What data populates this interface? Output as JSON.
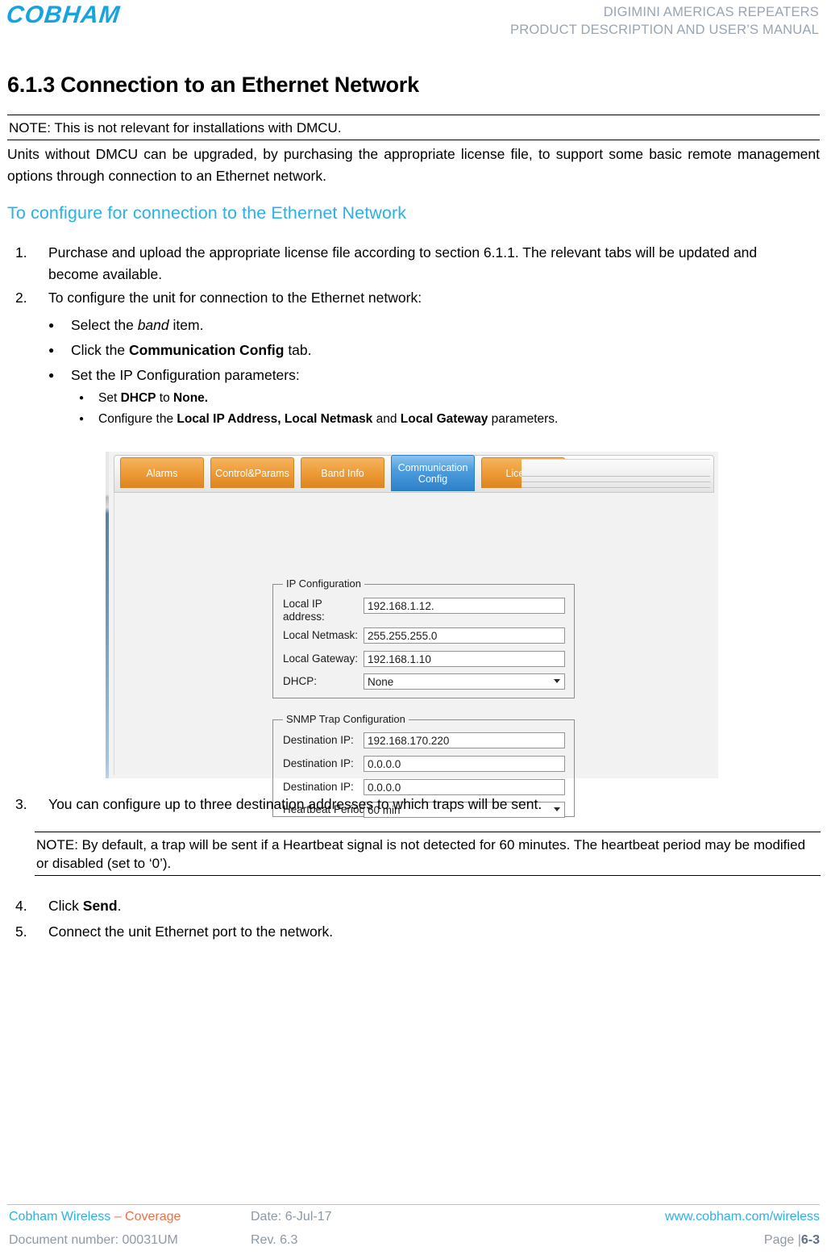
{
  "header": {
    "logo_text": "COBHAM",
    "line1": "DIGIMINI AMERICAS REPEATERS",
    "line2": "PRODUCT DESCRIPTION AND USER’S MANUAL"
  },
  "section": {
    "number": "6.1.3",
    "title": "Connection to an Ethernet Network"
  },
  "notes": {
    "note1": "NOTE: This is not relevant for installations with DMCU.",
    "note2": "NOTE: By default, a trap will be sent if a Heartbeat signal is not detected for 60 minutes. The heartbeat period may be modified or disabled (set to ‘0’)."
  },
  "intro_paragraph": "Units without DMCU can be upgraded, by purchasing the appropriate license file, to support some basic remote management options through connection to an Ethernet network.",
  "blue_heading": "To configure for connection to the Ethernet Network",
  "steps": [
    {
      "marker": "1.",
      "text": "Purchase and upload the appropriate license file according to section 6.1.1. The relevant tabs will be updated and become available."
    },
    {
      "marker": "2.",
      "text": "To configure the unit for connection to the Ethernet network:"
    },
    {
      "marker": "3.",
      "text": "You can configure up to three destination addresses to which traps will be sent."
    },
    {
      "marker": "4.",
      "text_pre": "Click ",
      "text_bold": "Send",
      "text_post": "."
    },
    {
      "marker": "5.",
      "text": "Connect the unit Ethernet port to the network."
    }
  ],
  "bullets": [
    {
      "pre": "Select the ",
      "em": "band",
      "post": " item."
    },
    {
      "pre": "Click the ",
      "bold": "Communication Config",
      "post": " tab."
    },
    {
      "pre": "Set the IP Configuration parameters:",
      "em": "",
      "post": ""
    }
  ],
  "sub_bullets": [
    {
      "pre": "Set ",
      "bold1": "DHCP",
      "mid": " to ",
      "bold2": "None.",
      "post": ""
    },
    {
      "pre": "Configure the ",
      "bold1": "Local IP Address, Local Netmask",
      "mid": " and ",
      "bold2": "Local Gateway",
      "post": " parameters."
    }
  ],
  "app_screenshot": {
    "tabs": [
      {
        "label": "Alarms",
        "active": false
      },
      {
        "label": "Control&Params",
        "active": false
      },
      {
        "label": "Band Info",
        "active": false
      },
      {
        "label": "Communication Config",
        "active": true
      },
      {
        "label": "License",
        "active": false
      }
    ],
    "ip_configuration": {
      "legend": "IP Configuration",
      "fields": [
        {
          "label": "Local IP\naddress:",
          "value": "192.168.1.12.",
          "type": "text"
        },
        {
          "label": "Local Netmask:",
          "value": "255.255.255.0",
          "type": "text"
        },
        {
          "label": "Local Gateway:",
          "value": "192.168.1.10",
          "type": "text"
        },
        {
          "label": "DHCP:",
          "value": "None",
          "type": "select"
        }
      ]
    },
    "snmp_trap_configuration": {
      "legend": "SNMP Trap Configuration",
      "fields": [
        {
          "label": "Destination IP:",
          "value": "192.168.170.220",
          "type": "text"
        },
        {
          "label": "Destination IP:",
          "value": "0.0.0.0",
          "type": "text"
        },
        {
          "label": "Destination IP:",
          "value": "0.0.0.0",
          "type": "text"
        },
        {
          "label": "Heartbeat Period",
          "value": "60 min",
          "type": "select"
        }
      ]
    }
  },
  "footer": {
    "company": "Cobham Wireless ",
    "company_suffix": "– Coverage",
    "date": "Date: 6-Jul-17",
    "website": "www.cobham.com/wireless",
    "doc_number": "Document number: 00031UM",
    "revision": "Rev. 6.3",
    "page_label": "Page |",
    "page_number": "6-3"
  },
  "colors": {
    "brand_blue": "#2bb0e8",
    "accent_orange": "#ef6f43",
    "header_grey": "#98a5b3",
    "tab_orange": "#ee9c37",
    "tab_active_blue": "#4e9ede"
  }
}
